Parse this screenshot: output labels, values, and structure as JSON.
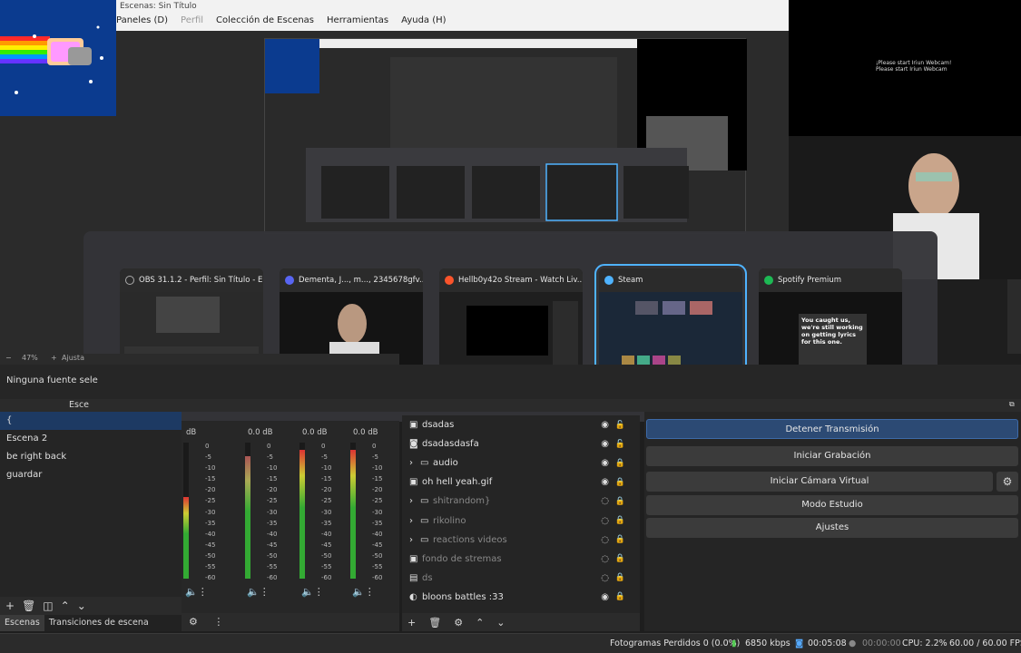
{
  "window": {
    "title": "Escenas: Sin Título",
    "menu": [
      "Paneles (D)",
      "Perfil",
      "Colección de Escenas",
      "Herramientas",
      "Ayuda (H)"
    ]
  },
  "webcam_overlay_text": [
    "¡Please start Iriun Webcam!",
    "Please start Iriun Webcam"
  ],
  "task_switcher": {
    "cards": [
      {
        "title": "OBS 31.1.2 - Perfil: Sin Título - E...",
        "icon": "obs-icon",
        "color": "#888888"
      },
      {
        "title": "Dementa, J..., m..., 2345678gfv...",
        "icon": "discord-icon",
        "color": "#5865f2"
      },
      {
        "title": "Hellb0y42o Stream - Watch Liv...",
        "icon": "brave-icon",
        "color": "#fb542b"
      },
      {
        "title": "Steam",
        "icon": "steam-icon",
        "color": "#4fb3ff",
        "selected": true
      },
      {
        "title": "Spotify Premium",
        "icon": "spotify-icon",
        "color": "#1db954"
      }
    ],
    "spotify_msg": "You caught us, we're still working on getting lyrics for this one."
  },
  "preview": {
    "zoom": "47%",
    "zoom_label": "Ajusta"
  },
  "source_info": "Ninguna fuente sele",
  "docks": {
    "scenes_header": "Esce"
  },
  "scenes": [
    "{",
    "Escena 2",
    "be right back",
    "guardar"
  ],
  "dock_tabs": [
    "Escenas",
    "Transiciones de escena"
  ],
  "mixer": {
    "channels": [
      "dB",
      "0.0 dB",
      "0.0 dB",
      "0.0 dB"
    ],
    "scale": [
      "0",
      "-5",
      "-10",
      "-15",
      "-20",
      "-25",
      "-30",
      "-35",
      "-40",
      "-45",
      "-50",
      "-55",
      "-60"
    ]
  },
  "sources": [
    {
      "name": "dsadas",
      "type": "image",
      "visible": true,
      "folder": false
    },
    {
      "name": "dsadasdasfa",
      "type": "camera",
      "visible": true,
      "folder": false
    },
    {
      "name": "audio",
      "type": "folder",
      "visible": true,
      "folder": true
    },
    {
      "name": "oh hell yeah.gif",
      "type": "image",
      "visible": true,
      "folder": false
    },
    {
      "name": "shitrandom}",
      "type": "folder",
      "visible": false,
      "folder": true
    },
    {
      "name": "rikolino",
      "type": "folder",
      "visible": false,
      "folder": true
    },
    {
      "name": "reactions videos",
      "type": "folder",
      "visible": false,
      "folder": true
    },
    {
      "name": "fondo de stremas",
      "type": "image",
      "visible": false,
      "folder": false
    },
    {
      "name": "ds",
      "type": "window",
      "visible": false,
      "folder": false
    },
    {
      "name": "bloons battles :33",
      "type": "game",
      "visible": true,
      "folder": false
    }
  ],
  "controls": [
    "Detener Transmisión",
    "Iniciar Grabación",
    "Iniciar Cámara Virtual",
    "Modo Estudio",
    "Ajustes"
  ],
  "status": {
    "dropped": "Fotogramas Perdidos 0 (0.0%)",
    "bitrate": "6850 kbps",
    "stream_time": "00:05:08",
    "rec_time": "00:00:00",
    "cpu": "CPU: 2.2%",
    "fps": "60.00 / 60.00 FPS"
  }
}
